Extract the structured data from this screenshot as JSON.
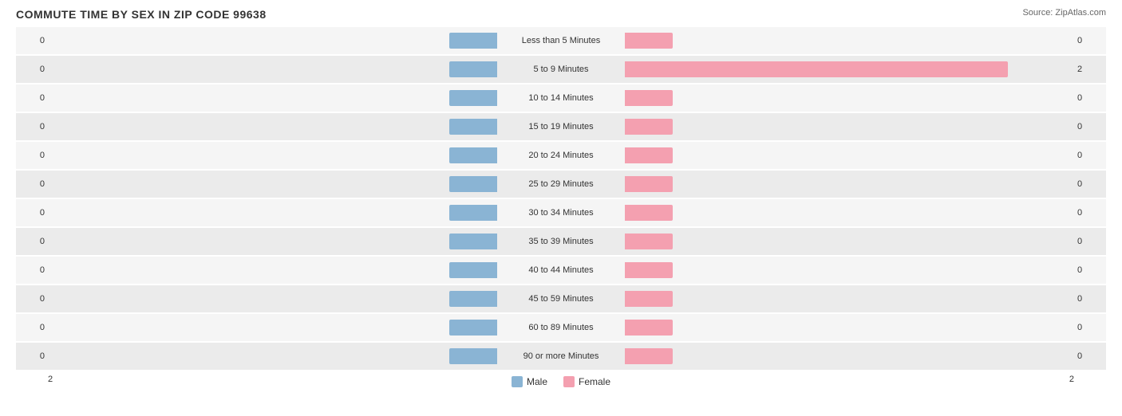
{
  "title": "COMMUTE TIME BY SEX IN ZIP CODE 99638",
  "source": "Source: ZipAtlas.com",
  "chart": {
    "max_value": 2,
    "max_bar_width": 500,
    "rows": [
      {
        "label": "Less than 5 Minutes",
        "male": 0,
        "female": 0
      },
      {
        "label": "5 to 9 Minutes",
        "male": 0,
        "female": 2
      },
      {
        "label": "10 to 14 Minutes",
        "male": 0,
        "female": 0
      },
      {
        "label": "15 to 19 Minutes",
        "male": 0,
        "female": 0
      },
      {
        "label": "20 to 24 Minutes",
        "male": 0,
        "female": 0
      },
      {
        "label": "25 to 29 Minutes",
        "male": 0,
        "female": 0
      },
      {
        "label": "30 to 34 Minutes",
        "male": 0,
        "female": 0
      },
      {
        "label": "35 to 39 Minutes",
        "male": 0,
        "female": 0
      },
      {
        "label": "40 to 44 Minutes",
        "male": 0,
        "female": 0
      },
      {
        "label": "45 to 59 Minutes",
        "male": 0,
        "female": 0
      },
      {
        "label": "60 to 89 Minutes",
        "male": 0,
        "female": 0
      },
      {
        "label": "90 or more Minutes",
        "male": 0,
        "female": 0
      }
    ],
    "legend": {
      "male_label": "Male",
      "female_label": "Female",
      "male_color": "#8ab4d4",
      "female_color": "#f4a0b0"
    },
    "axis_left": "2",
    "axis_right": "2"
  }
}
